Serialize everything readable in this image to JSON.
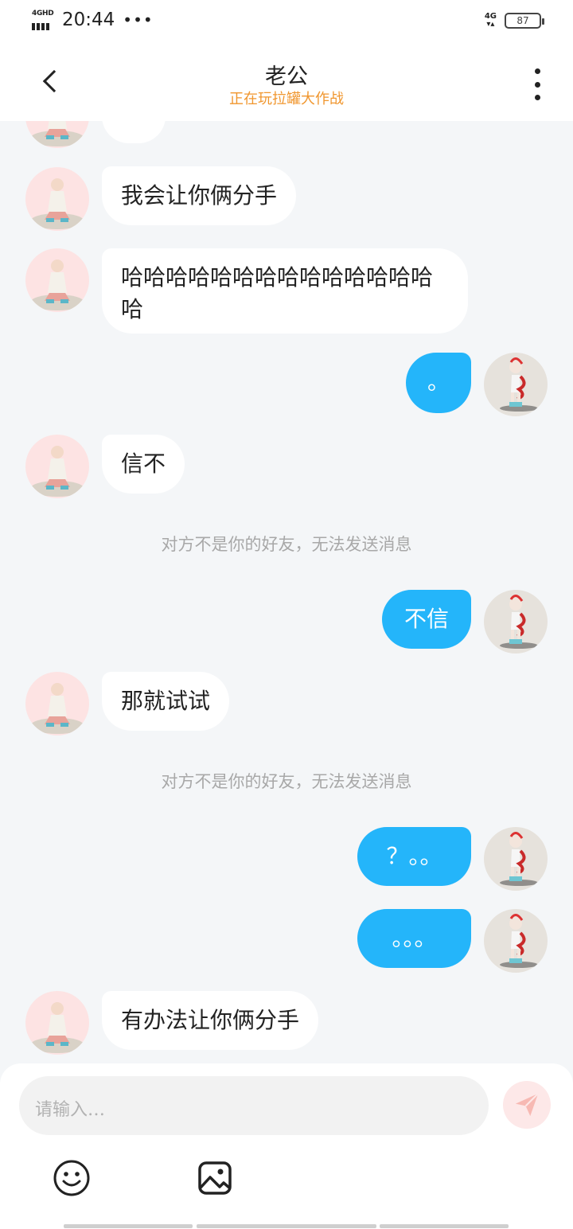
{
  "status_bar": {
    "network_label": "4GHD",
    "time": "20:44",
    "more": "•••",
    "network_right": "4G",
    "battery": "87"
  },
  "header": {
    "title": "老公",
    "subtitle": "正在玩拉罐大作战"
  },
  "messages": [
    {
      "side": "left",
      "text": "我会让你俩分手"
    },
    {
      "side": "left",
      "text": "哈哈哈哈哈哈哈哈哈哈哈哈哈哈哈"
    },
    {
      "side": "right",
      "text": "。"
    },
    {
      "side": "left",
      "text": "信不"
    },
    {
      "side": "system",
      "text": "对方不是你的好友，无法发送消息"
    },
    {
      "side": "right",
      "text": "不信"
    },
    {
      "side": "left",
      "text": "那就试试"
    },
    {
      "side": "system",
      "text": "对方不是你的好友，无法发送消息"
    },
    {
      "side": "right",
      "text": "？。。"
    },
    {
      "side": "right",
      "text": "。。。"
    },
    {
      "side": "left",
      "text": "有办法让你俩分手"
    }
  ],
  "partial_message": {
    "text": "…"
  },
  "input": {
    "placeholder": "请输入…"
  },
  "icons": {
    "back": "chevron-left-icon",
    "more": "more-vertical-icon",
    "send": "send-icon",
    "emoji": "emoji-icon",
    "image": "image-icon"
  },
  "colors": {
    "outgoing_bubble": "#24b5fa",
    "subtitle": "#f0962e",
    "background": "#f4f6f8"
  }
}
